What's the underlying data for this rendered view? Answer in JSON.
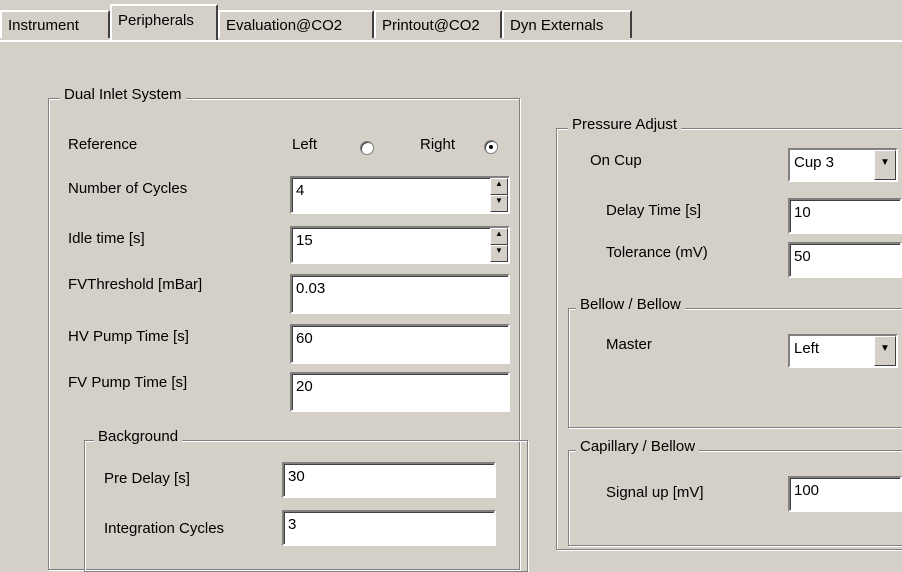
{
  "tabs": [
    {
      "label": "Instrument"
    },
    {
      "label": "Peripherals"
    },
    {
      "label": "Evaluation@CO2"
    },
    {
      "label": "Printout@CO2"
    },
    {
      "label": "Dyn Externals"
    }
  ],
  "active_tab": "Peripherals",
  "dual_inlet": {
    "title": "Dual Inlet System",
    "reference_label": "Reference",
    "left_label": "Left",
    "right_label": "Right",
    "reference_selected": "Right",
    "cycles_label": "Number of Cycles",
    "cycles_value": "4",
    "idle_label": "Idle time [s]",
    "idle_value": "15",
    "fv_threshold_label": "FVThreshold [mBar]",
    "fv_threshold_value": "0.03",
    "hv_pump_label": "HV Pump Time [s]",
    "hv_pump_value": "60",
    "fv_pump_label": "FV Pump Time [s]",
    "fv_pump_value": "20"
  },
  "background": {
    "title": "Background",
    "pre_delay_label": "Pre Delay [s]",
    "pre_delay_value": "30",
    "integration_label": "Integration Cycles",
    "integration_value": "3"
  },
  "pressure_adjust": {
    "title": "Pressure Adjust",
    "on_cup_label": "On Cup",
    "on_cup_value": "Cup 3",
    "delay_label": "Delay Time [s]",
    "delay_value": "10",
    "tolerance_label": "Tolerance (mV)",
    "tolerance_value": "50"
  },
  "bellow": {
    "title": "Bellow / Bellow",
    "master_label": "Master",
    "master_value": "Left"
  },
  "capillary": {
    "title": "Capillary / Bellow",
    "signal_label": "Signal up [mV]",
    "signal_value": "100"
  },
  "icons": {
    "spin_up": "spin-up-icon",
    "spin_down": "spin-down-icon",
    "dropdown": "chevron-down-icon"
  }
}
